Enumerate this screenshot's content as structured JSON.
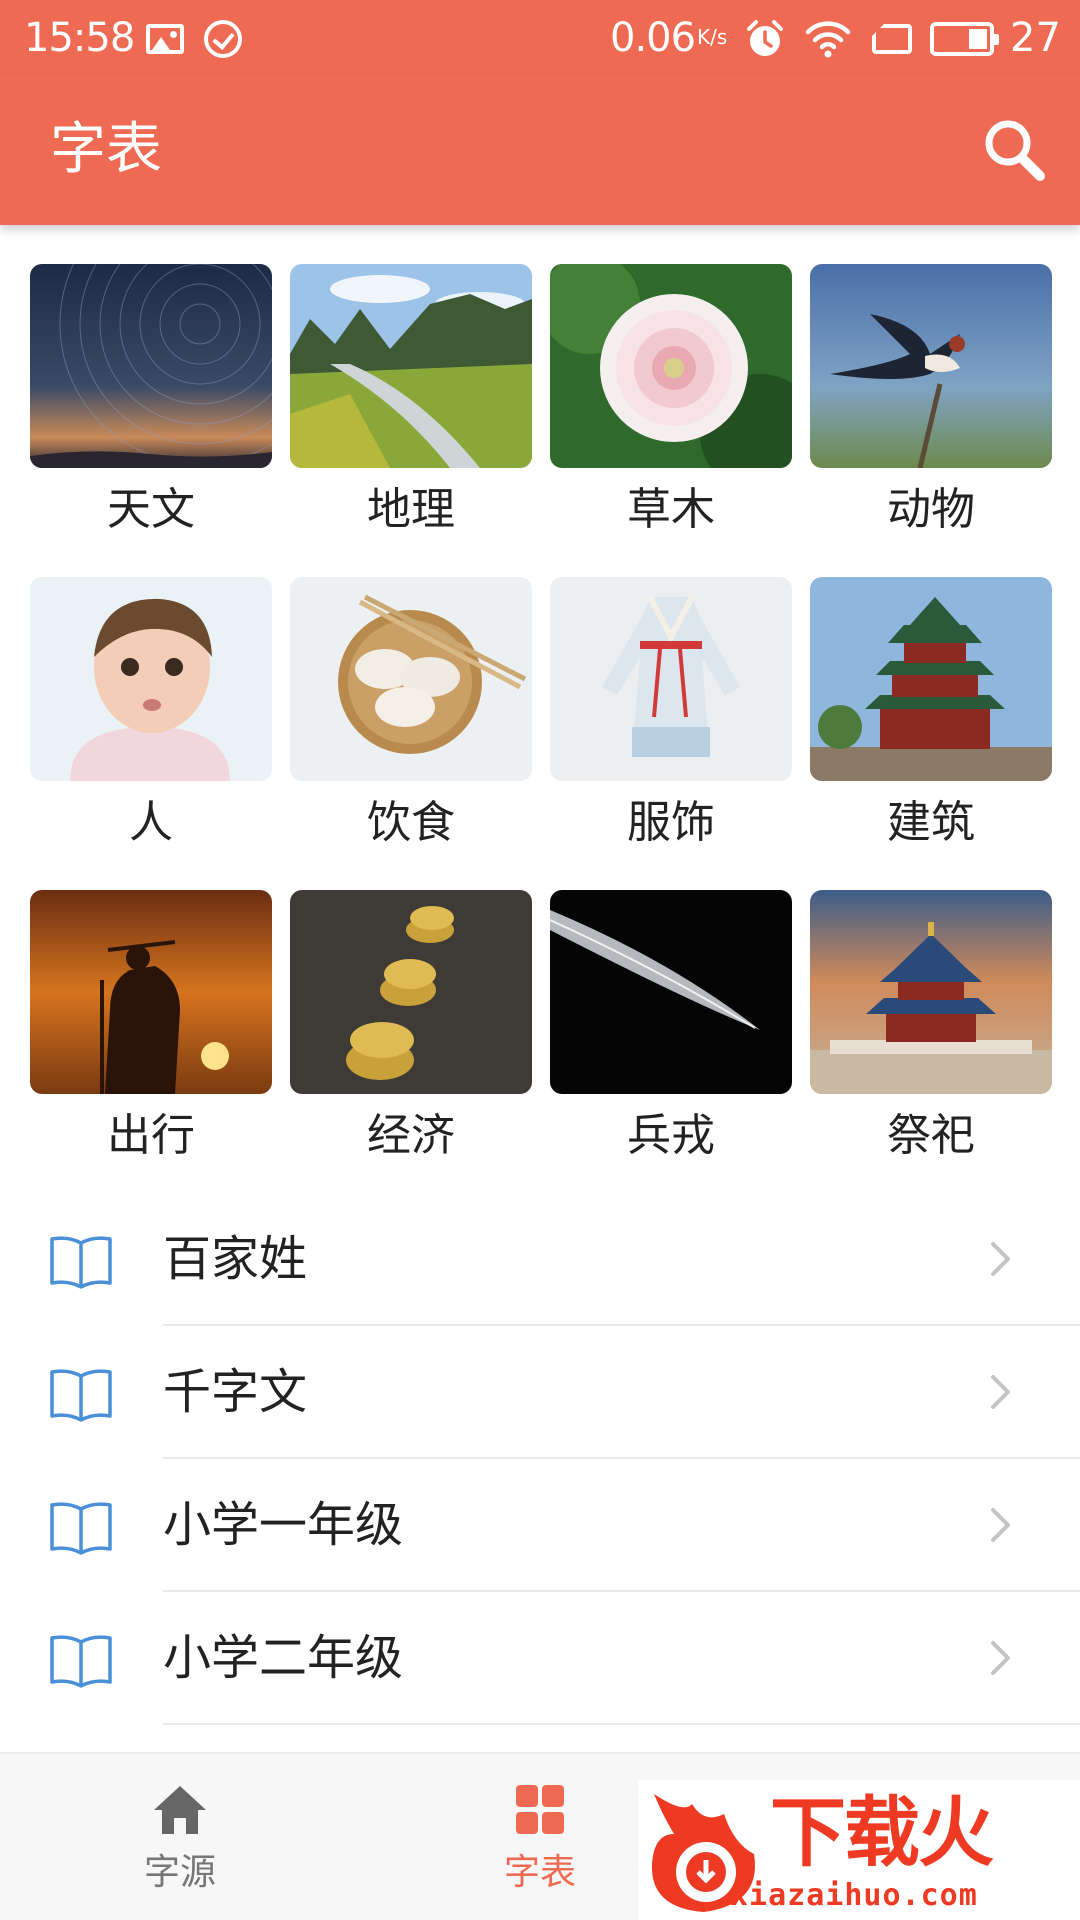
{
  "status_bar": {
    "time": "15:58",
    "net_speed": "0.06",
    "net_speed_unit": "K/s",
    "battery_level": "27",
    "icons": [
      "image-icon",
      "check-circle-icon",
      "alarm-icon",
      "wifi-icon",
      "sim-icon",
      "battery-icon"
    ]
  },
  "app_bar": {
    "title": "字表",
    "search_icon": "search-icon"
  },
  "categories": [
    {
      "label": "天文"
    },
    {
      "label": "地理"
    },
    {
      "label": "草木"
    },
    {
      "label": "动物"
    },
    {
      "label": "人"
    },
    {
      "label": "饮食"
    },
    {
      "label": "服饰"
    },
    {
      "label": "建筑"
    },
    {
      "label": "出行"
    },
    {
      "label": "经济"
    },
    {
      "label": "兵戎"
    },
    {
      "label": "祭祀"
    }
  ],
  "book_list": [
    {
      "label": "百家姓",
      "icon": "book-icon"
    },
    {
      "label": "千字文",
      "icon": "book-icon"
    },
    {
      "label": "小学一年级",
      "icon": "book-icon"
    },
    {
      "label": "小学二年级",
      "icon": "book-icon"
    }
  ],
  "bottom_nav": {
    "items": [
      {
        "label": "字源",
        "icon": "home-icon",
        "active": false
      },
      {
        "label": "字表",
        "icon": "grid-icon",
        "active": true
      }
    ]
  },
  "watermark": {
    "brand": "下载火",
    "domain": "xiazaihuo.com"
  },
  "colors": {
    "accent": "#ee6a52",
    "book_icon": "#4a90d9",
    "text": "#222222",
    "divider": "#e8e8e8"
  }
}
